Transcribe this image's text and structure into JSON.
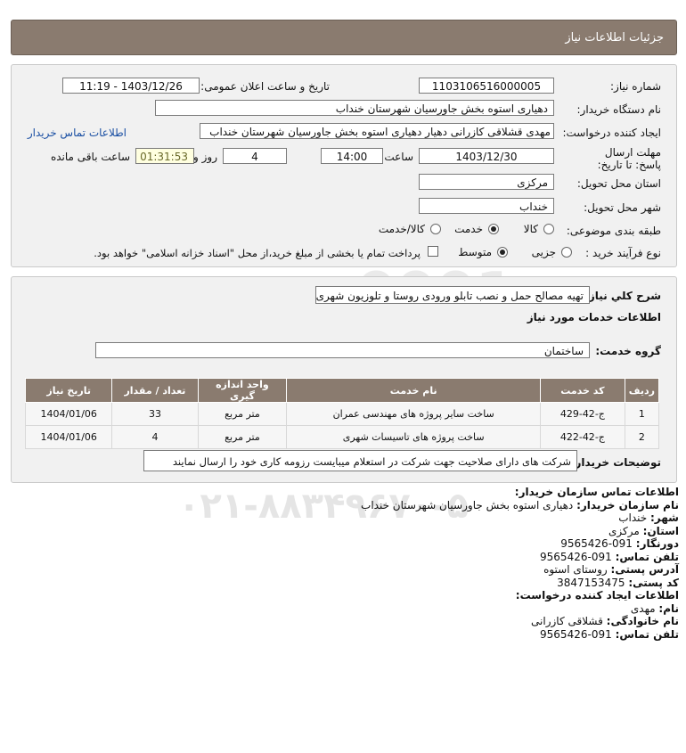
{
  "header": {
    "title": "جزئیات اطلاعات نیاز"
  },
  "form": {
    "need_number_label": "شماره نیاز:",
    "need_number": "1103106516000005",
    "announce_label": "تاریخ و ساعت اعلان عمومی:",
    "announce_value": "1403/12/26 - 11:19",
    "buyer_org_label": "نام دستگاه خریدار:",
    "buyer_org": "دهیاری استوه بخش جاورسیان شهرستان خنداب",
    "creator_label": "ایجاد کننده درخواست:",
    "creator": "مهدی قشلاقی کازرانی دهیار دهیاری استوه بخش جاورسیان شهرستان خنداب",
    "contact_link": "اطلاعات تماس خریدار",
    "deadline_label": "مهلت ارسال پاسخ: تا تاریخ:",
    "deadline_date": "1403/12/30",
    "time_label": "ساعت",
    "deadline_time": "14:00",
    "days": "4",
    "days_label": "روز و",
    "remaining": "01:31:53",
    "remaining_label": "ساعت باقی مانده",
    "province_label": "استان محل تحویل:",
    "province": "مرکزی",
    "city_label": "شهر محل تحویل:",
    "city": "خنداب",
    "category_label": "طبقه بندی موضوعی:",
    "category_options": [
      "کالا",
      "خدمت",
      "کالا/خدمت"
    ],
    "process_label": "نوع فرآیند خرید :",
    "process_options": [
      "جزیی",
      "متوسط"
    ],
    "payment_note": "پرداخت تمام یا بخشی از مبلغ خرید،از محل \"اسناد خزانه اسلامی\" خواهد بود."
  },
  "details": {
    "summary_label": "شرح کلي نياز:",
    "summary": "تهیه مصالح حمل و نصب تابلو ورودی روستا و تلوزیون شهری",
    "services_heading": "اطلاعات خدمات مورد نیاز",
    "service_group_label": "گروه خدمت:",
    "service_group": "ساختمان",
    "table": {
      "headers": [
        "ردیف",
        "کد خدمت",
        "نام خدمت",
        "واحد اندازه گیری",
        "تعداد / مقدار",
        "تاریخ نیاز"
      ],
      "rows": [
        [
          "1",
          "ج-42-429",
          "ساخت سایر پروژه های مهندسی عمران",
          "متر مربع",
          "33",
          "1404/01/06"
        ],
        [
          "2",
          "ج-42-422",
          "ساخت پروژه های تاسیسات شهری",
          "متر مربع",
          "4",
          "1404/01/06"
        ]
      ]
    },
    "buyer_notes_label": "توضیحات خریدار:",
    "buyer_notes": "شرکت های دارای صلاحیت جهت شرکت در استعلام میبایست رزومه کاری خود را ارسال نمایند"
  },
  "contact": {
    "org_heading": "اطلاعات تماس سازمان خریدار:",
    "org_name_label": "نام سازمان خریدار:",
    "org_name": "دهیاری استوه بخش جاورسیان شهرستان خنداب",
    "city_label": "شهر:",
    "city": "خنداب",
    "province_label": "استان:",
    "province": "مرکزی",
    "fax_label": "دورنگار:",
    "fax": "091-9565426",
    "phone_label": "تلفن تماس:",
    "phone": "091-9565426",
    "address_label": "آدرس پستی:",
    "address": "روستای استوه",
    "postal_label": "کد پستی:",
    "postal": "3847153475",
    "creator_heading": "اطلاعات ایجاد کننده درخواست:",
    "first_name_label": "نام:",
    "first_name": "مهدی",
    "last_name_label": "نام خانوادگی:",
    "last_name": "قشلاقی کازرانی",
    "creator_phone_label": "تلفن تماس:",
    "creator_phone": "091-9565426"
  }
}
